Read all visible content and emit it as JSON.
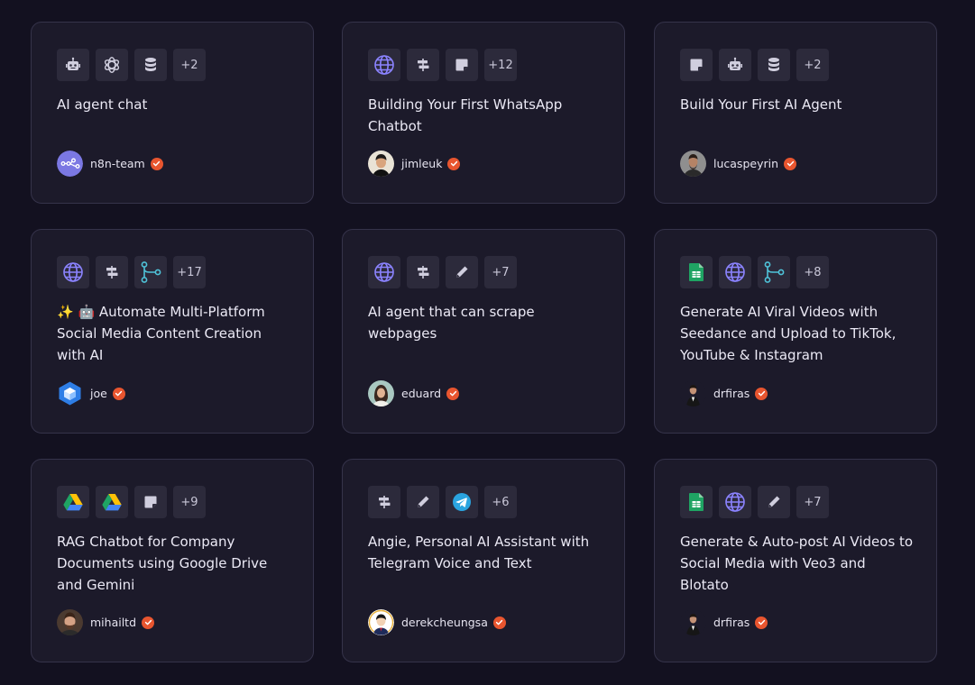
{
  "cards": [
    {
      "title": "AI agent chat",
      "icons": [
        "robot-icon",
        "openai-icon",
        "database-icon"
      ],
      "more": "+2",
      "author": "n8n-team",
      "verified": true
    },
    {
      "title": "Building Your First WhatsApp Chatbot",
      "icons": [
        "globe-icon",
        "signpost-icon",
        "sticky-note-icon"
      ],
      "more": "+12",
      "author": "jimleuk",
      "verified": true
    },
    {
      "title": "Build Your First AI Agent",
      "icons": [
        "sticky-note-icon",
        "robot-icon",
        "database-icon"
      ],
      "more": "+2",
      "author": "lucaspeyrin",
      "verified": true
    },
    {
      "title": "✨ 🤖 Automate Multi-Platform Social Media Content Creation with AI",
      "icons": [
        "globe-icon",
        "signpost-icon",
        "merge-icon"
      ],
      "more": "+17",
      "author": "joe",
      "verified": true
    },
    {
      "title": "AI agent that can scrape webpages",
      "icons": [
        "globe-icon",
        "signpost-icon",
        "pencil-icon"
      ],
      "more": "+7",
      "author": "eduard",
      "verified": true
    },
    {
      "title": "Generate AI Viral Videos with Seedance and Upload to TikTok, YouTube & Instagram",
      "icons": [
        "google-sheets-icon",
        "globe-icon",
        "merge-icon"
      ],
      "more": "+8",
      "author": "drfiras",
      "verified": true
    },
    {
      "title": "RAG Chatbot for Company Documents using Google Drive and Gemini",
      "icons": [
        "google-drive-icon",
        "google-drive-icon",
        "sticky-note-icon"
      ],
      "more": "+9",
      "author": "mihailtd",
      "verified": true
    },
    {
      "title": "Angie, Personal AI Assistant with Telegram Voice and Text",
      "icons": [
        "signpost-icon",
        "pencil-icon",
        "telegram-icon"
      ],
      "more": "+6",
      "author": "derekcheungsa",
      "verified": true
    },
    {
      "title": "Generate & Auto-post AI Videos to Social Media with Veo3 and Blotato",
      "icons": [
        "google-sheets-icon",
        "globe-icon",
        "pencil-icon"
      ],
      "more": "+7",
      "author": "drfiras",
      "verified": true
    }
  ],
  "colors": {
    "background": "#131120",
    "card": "#1c1a2a",
    "card_border": "#35334a",
    "icon_box": "#2c2a3b",
    "verified_badge": "#e8552f",
    "globe": "#8b83ff",
    "merge": "#4fc3d9",
    "sheets": "#1fa463",
    "telegram": "#2aa4e0"
  }
}
